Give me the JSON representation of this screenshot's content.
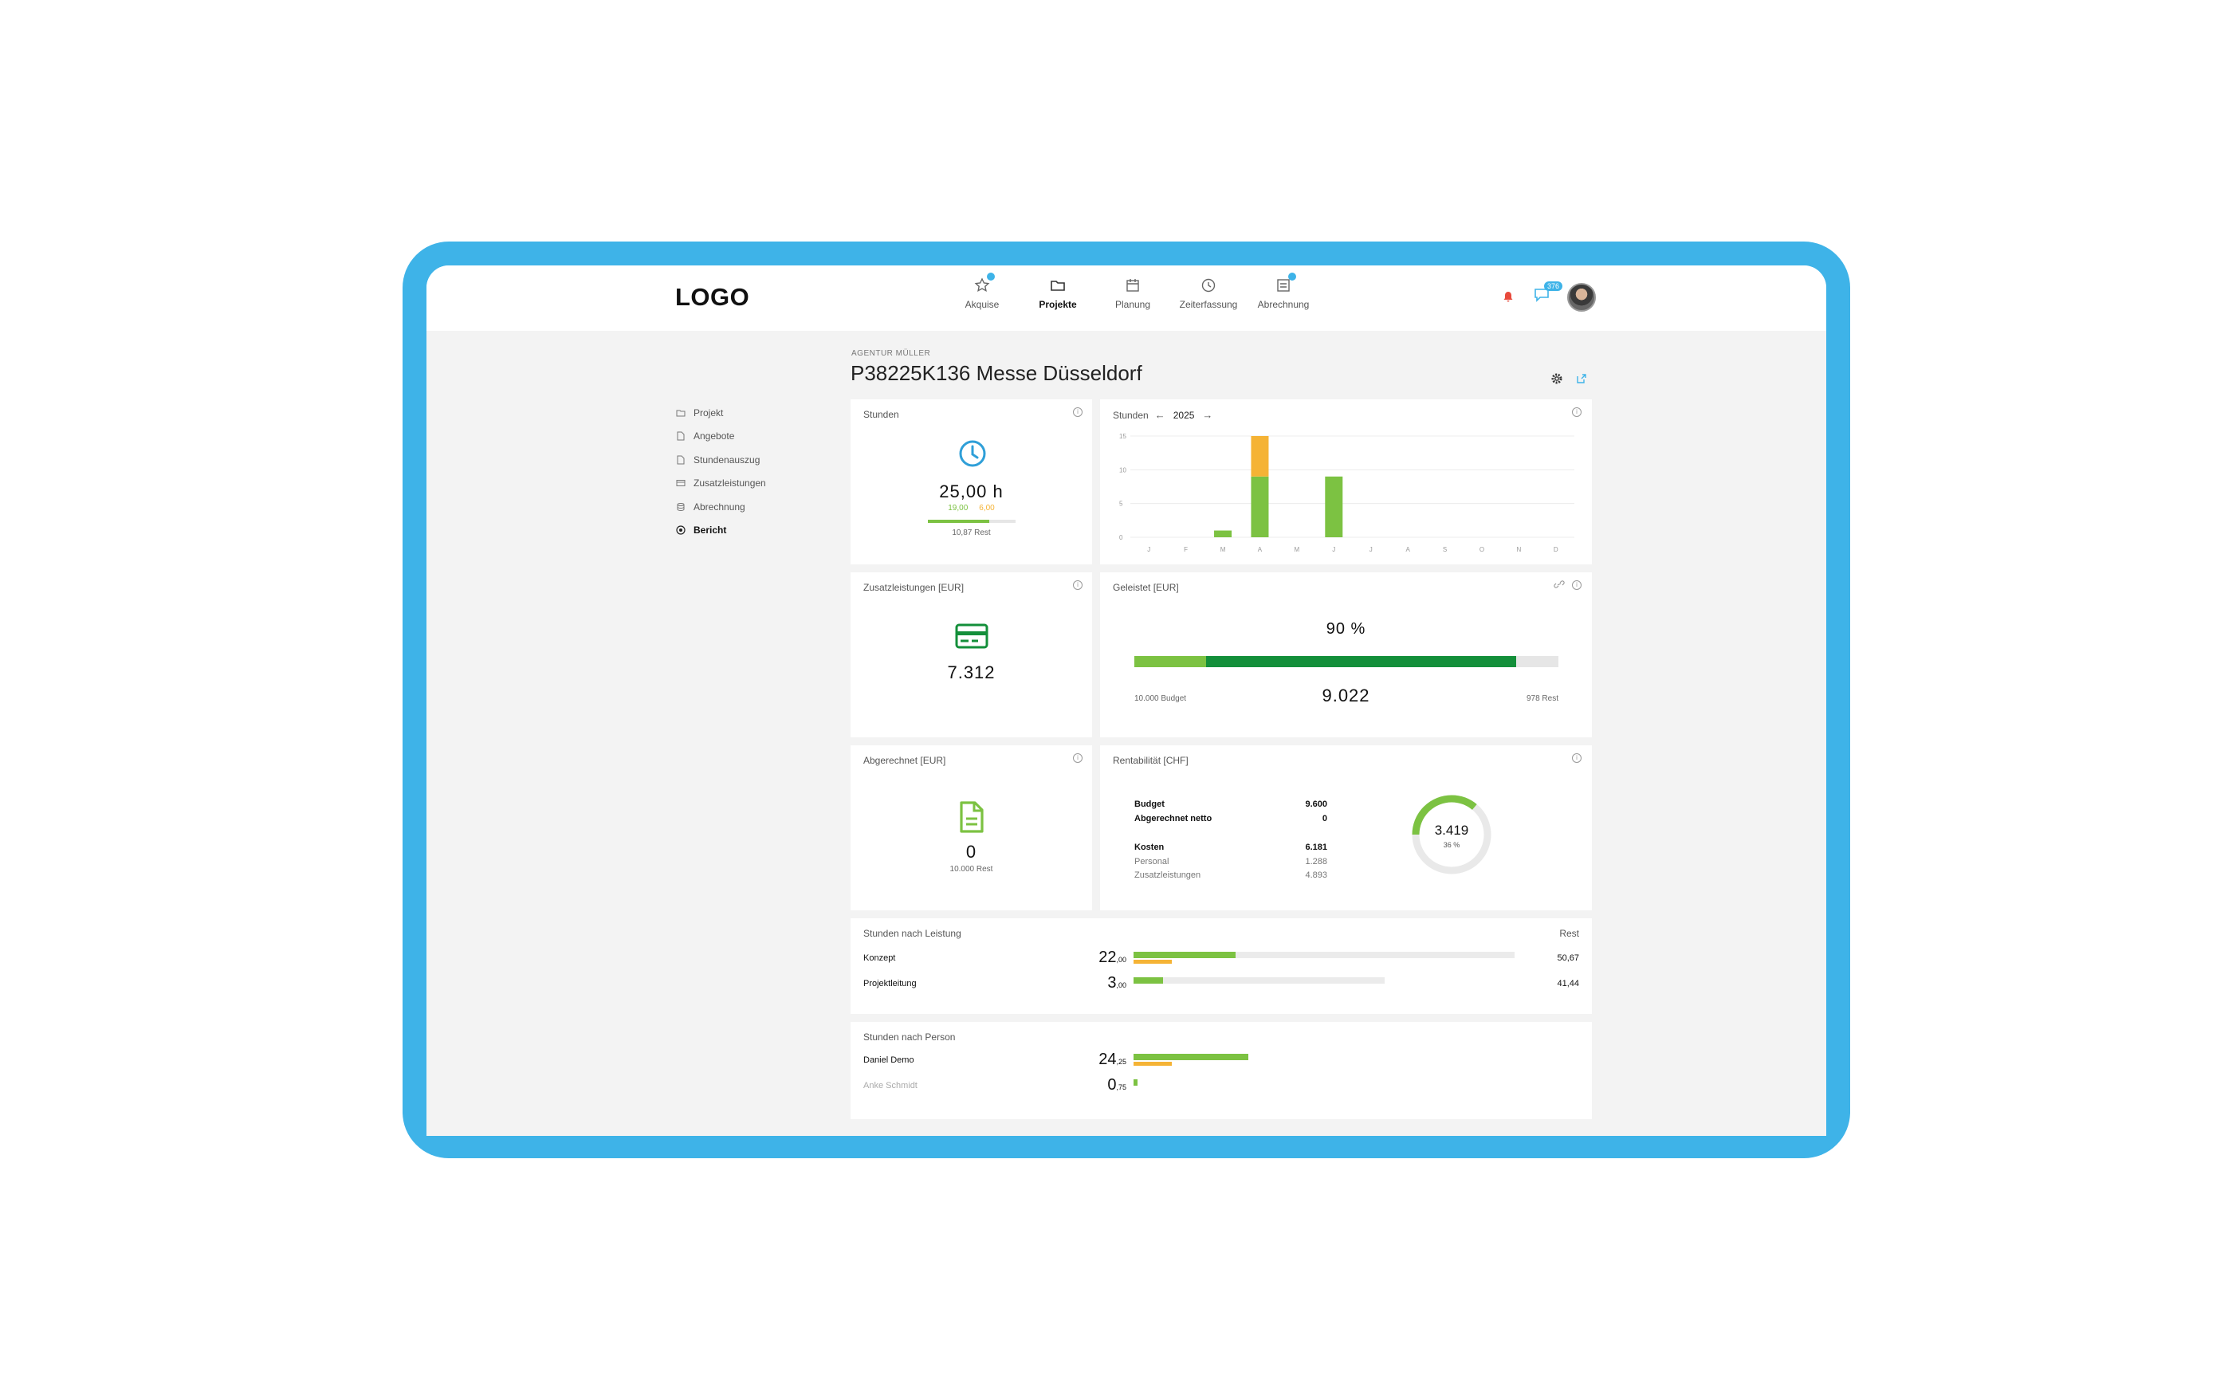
{
  "app": {
    "logo": "LOGO"
  },
  "nav": [
    {
      "label": "Akquise"
    },
    {
      "label": "Projekte"
    },
    {
      "label": "Planung"
    },
    {
      "label": "Zeiterfassung"
    },
    {
      "label": "Abrechnung"
    }
  ],
  "header": {
    "chat_count": "376"
  },
  "sidebar": {
    "items": [
      {
        "label": "Projekt"
      },
      {
        "label": "Angebote"
      },
      {
        "label": "Stundenauszug"
      },
      {
        "label": "Zusatzleistungen"
      },
      {
        "label": "Abrechnung"
      },
      {
        "label": "Bericht"
      }
    ]
  },
  "project": {
    "agency": "AGENTUR MÜLLER",
    "title": "P38225K136 Messe Düsseldorf"
  },
  "hours_card": {
    "title": "Stunden",
    "value": "25,00 h",
    "green": "19,00",
    "orange": "6,00",
    "rest": "10,87 Rest",
    "progress": 0.7
  },
  "hours_chart": {
    "title": "Stunden",
    "year": "2025"
  },
  "chart_data": {
    "type": "bar",
    "categories": [
      "J",
      "F",
      "M",
      "A",
      "M",
      "J",
      "J",
      "A",
      "S",
      "O",
      "N",
      "D"
    ],
    "yticks": [
      "15",
      "10",
      "5",
      "0"
    ],
    "ylim": [
      0,
      15
    ],
    "series": [
      {
        "values": [
          0,
          0,
          1,
          9,
          0,
          9,
          0,
          0,
          0,
          0,
          0,
          0
        ]
      },
      {
        "values": [
          0,
          0,
          0,
          6,
          0,
          0,
          0,
          0,
          0,
          0,
          0,
          0
        ]
      }
    ]
  },
  "extra_card": {
    "title": "Zusatzleistungen [EUR]",
    "value": "7.312"
  },
  "done_card": {
    "title": "Geleistet [EUR]",
    "percent": "90 %",
    "budget": "10.000 Budget",
    "value": "9.022",
    "rest": "978 Rest",
    "light_fraction": 0.17,
    "dark_fraction": 0.73
  },
  "billed_card": {
    "title": "Abgerechnet [EUR]",
    "value": "0",
    "rest": "10.000 Rest"
  },
  "profit_card": {
    "title": "Rentabilität [CHF]",
    "rows": [
      {
        "label": "Budget",
        "value": "9.600",
        "bold": true
      },
      {
        "label": "Abgerechnet netto",
        "value": "0",
        "bold": true
      },
      {
        "label": "Kosten",
        "value": "6.181",
        "bold": true
      },
      {
        "label": "Personal",
        "value": "1.288",
        "bold": false
      },
      {
        "label": "Zusatzleistungen",
        "value": "4.893",
        "bold": false
      }
    ],
    "donut_value": "3.419",
    "donut_percent": "36 %",
    "donut_fraction": 0.36
  },
  "service_card": {
    "title": "Stunden nach Leistung",
    "rest_label": "Rest",
    "rows": [
      {
        "label": "Konzept",
        "int": "22",
        "dec": ",00",
        "rest": "50,67",
        "green": 0.24,
        "orange": 0.09
      },
      {
        "label": "Projektleitung",
        "int": "3",
        "dec": ",00",
        "rest": "41,44",
        "green": 0.07,
        "orange": 0
      }
    ]
  },
  "person_card": {
    "title": "Stunden nach Person",
    "rows": [
      {
        "label": "Daniel Demo",
        "int": "24",
        "dec": ",25",
        "green": 0.27,
        "orange": 0.09
      },
      {
        "label": "Anke Schmidt",
        "int": "0",
        "dec": ",75",
        "green": 0.01,
        "orange": 0
      }
    ]
  }
}
